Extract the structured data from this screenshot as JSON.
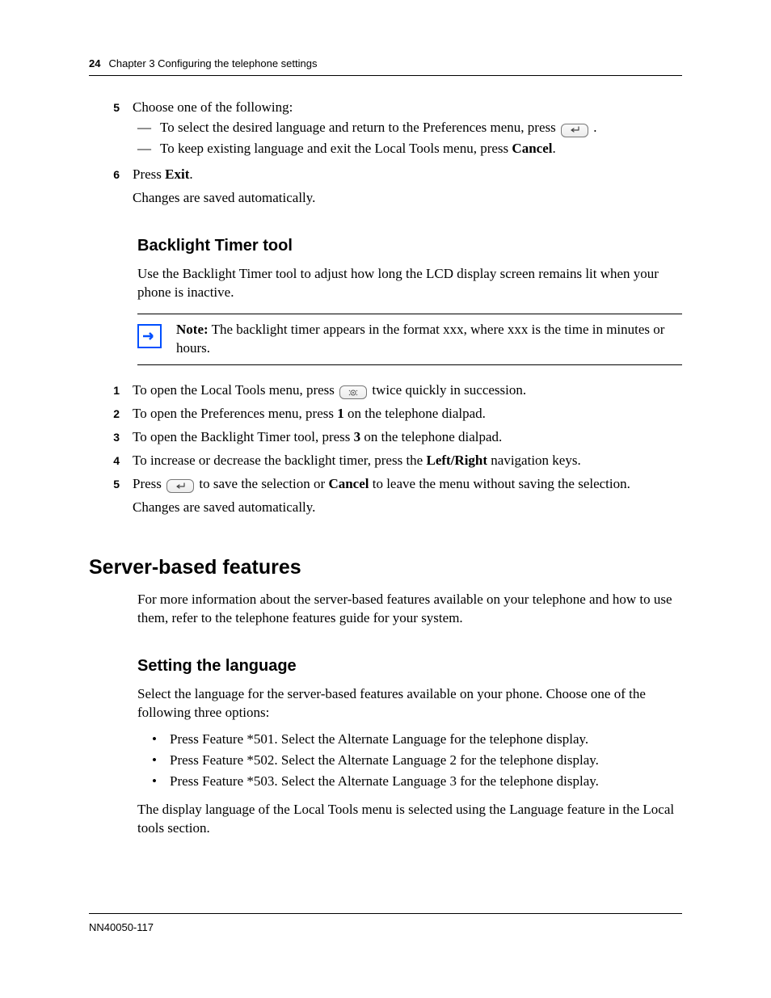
{
  "header": {
    "page_num": "24",
    "chapter": "Chapter 3  Configuring the telephone settings"
  },
  "step5": {
    "num": "5",
    "intro": "Choose one of the following:",
    "a_pre": "To select the desired language and return to the Preferences menu, press ",
    "a_post": ".",
    "b_pre": "To keep existing language and exit the Local Tools menu, press ",
    "b_bold": "Cancel",
    "b_post": "."
  },
  "step6": {
    "num": "6",
    "line_pre": "Press ",
    "line_bold": "Exit",
    "line_post": ".",
    "after": "Changes are saved automatically."
  },
  "backlight": {
    "title": "Backlight Timer tool",
    "intro": "Use the Backlight Timer tool to adjust how long the LCD display screen remains lit when your phone is inactive.",
    "note_label": "Note:",
    "note_body": " The backlight timer appears in the format xxx, where xxx is the time in minutes or hours.",
    "s1": {
      "num": "1",
      "pre": "To open the Local Tools menu, press ",
      "post": " twice quickly in succession."
    },
    "s2": {
      "num": "2",
      "pre": "To open the Preferences menu, press ",
      "bold": "1",
      "post": " on the telephone dialpad."
    },
    "s3": {
      "num": "3",
      "pre": "To open the Backlight Timer tool, press ",
      "bold": "3",
      "post": " on the telephone dialpad."
    },
    "s4": {
      "num": "4",
      "pre": "To increase or decrease the backlight timer, press the ",
      "bold": "Left/Right",
      "post": " navigation keys."
    },
    "s5": {
      "num": "5",
      "pre": "Press ",
      "mid": " to save the selection or ",
      "bold": "Cancel",
      "post": " to leave the menu without saving the selection.",
      "after": "Changes are saved automatically."
    }
  },
  "server": {
    "title": "Server-based features",
    "intro": "For more information about the server-based features available on your telephone and how to use them, refer to the telephone features guide for your system."
  },
  "lang": {
    "title": "Setting the language",
    "intro": "Select the language for the server-based features available on your phone. Choose one of the following three options:",
    "b1": "Press Feature *501. Select the Alternate Language for the telephone display.",
    "b2": "Press Feature *502. Select the Alternate Language 2 for the telephone display.",
    "b3": "Press Feature *503. Select the Alternate Language 3 for the telephone display.",
    "outro": "The display language of the Local Tools menu is selected using the Language feature in the Local tools section."
  },
  "footer": {
    "docnum": "NN40050-117"
  }
}
